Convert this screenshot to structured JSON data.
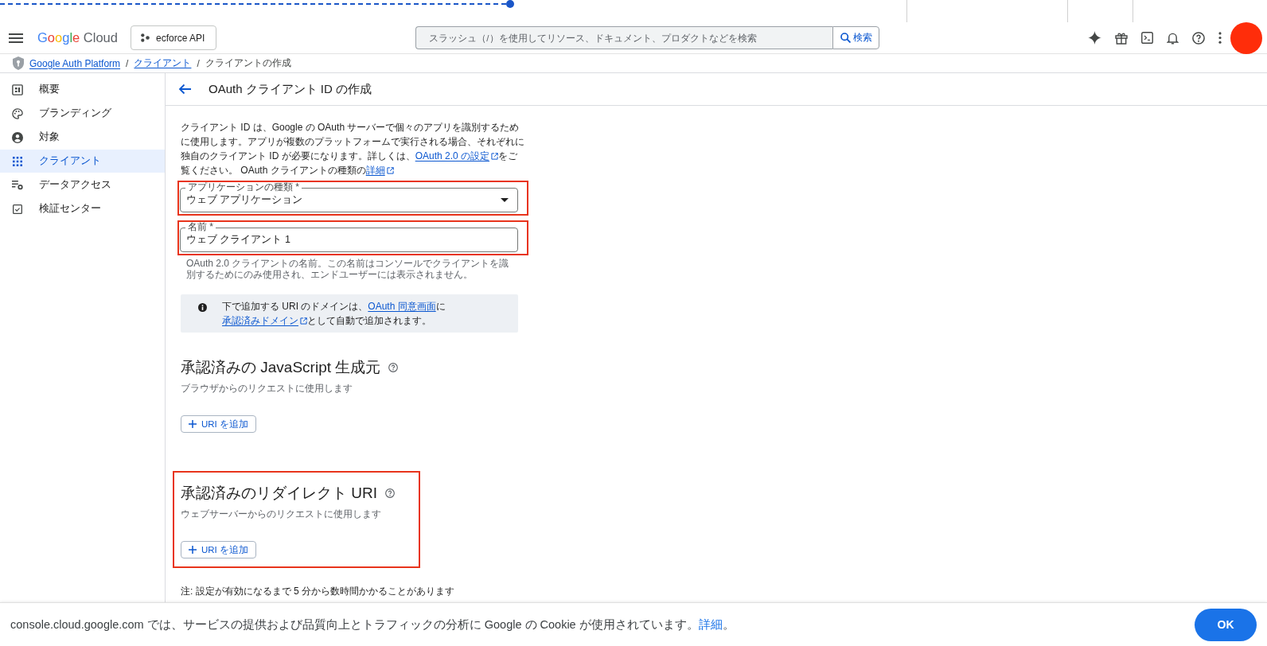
{
  "header": {
    "logo": {
      "brand": "Google",
      "product": "Cloud"
    },
    "project": "ecforce API",
    "search": {
      "placeholder": "スラッシュ（/）を使用してリソース、ドキュメント、プロダクトなどを検索",
      "button": "検索"
    }
  },
  "breadcrumb": [
    {
      "kind": "link",
      "text": "Google Auth Platform"
    },
    {
      "kind": "separator",
      "text": "/"
    },
    {
      "kind": "link",
      "text": "クライアント"
    },
    {
      "kind": "separator",
      "text": "/"
    },
    {
      "kind": "current",
      "text": "クライアントの作成"
    }
  ],
  "sidebar": {
    "items": [
      {
        "label": "概要",
        "selected": false
      },
      {
        "label": "ブランディング",
        "selected": false
      },
      {
        "label": "対象",
        "selected": false
      },
      {
        "label": "クライアント",
        "selected": true
      },
      {
        "label": "データアクセス",
        "selected": false
      },
      {
        "label": "検証センター",
        "selected": false
      }
    ]
  },
  "page": {
    "title": "OAuth クライアント ID の作成",
    "intro": [
      {
        "kind": "text",
        "text": "クライアント ID は、Google の OAuth サーバーで個々のアプリを識別するために使用します。アプリが複数のプラットフォームで実行される場合、それぞれに独自のクライアント ID が必要になります。詳しくは、"
      },
      {
        "kind": "link",
        "text": "OAuth 2.0 の設定",
        "external": true
      },
      {
        "kind": "text",
        "text": "をご覧ください。 OAuth クライアントの種類の"
      },
      {
        "kind": "link",
        "text": "詳細",
        "external": true
      }
    ],
    "fields": [
      {
        "kind": "select",
        "label": "アプリケーションの種類 *",
        "value": "ウェブ アプリケーション",
        "highlighted": true
      },
      {
        "kind": "text",
        "label": "名前 *",
        "value": "ウェブ クライアント 1",
        "highlighted": true,
        "helper": "OAuth 2.0 クライアントの名前。この名前はコンソールでクライアントを識別するためにのみ使用され、エンドユーザーには表示されません。"
      }
    ],
    "notice": [
      {
        "kind": "text",
        "text": "下で追加する URI のドメインは、"
      },
      {
        "kind": "link",
        "text": "OAuth 同意画面",
        "external": false
      },
      {
        "kind": "text",
        "text": "に"
      },
      {
        "kind": "link",
        "text": "承認済みドメイン",
        "external": true
      },
      {
        "kind": "text",
        "text": "として自動で追加されます。"
      }
    ],
    "sections": [
      {
        "title": "承認済みの JavaScript 生成元",
        "description": "ブラウザからのリクエストに使用します",
        "button": "URI を追加",
        "highlighted": false
      },
      {
        "title": "承認済みのリダイレクト URI",
        "description": "ウェブサーバーからのリクエストに使用します",
        "button": "URI を追加",
        "highlighted": true
      }
    ],
    "note": "注: 設定が有効になるまで 5 分から数時間かかることがあります"
  },
  "cookie_banner": {
    "message": [
      {
        "kind": "text",
        "text": "console.cloud.google.com では、サービスの提供および品質向上とトラフィックの分析に Google の Cookie が使用されています。"
      },
      {
        "kind": "link",
        "text": "詳細"
      },
      {
        "kind": "text",
        "text": "。"
      }
    ],
    "button": "OK"
  }
}
